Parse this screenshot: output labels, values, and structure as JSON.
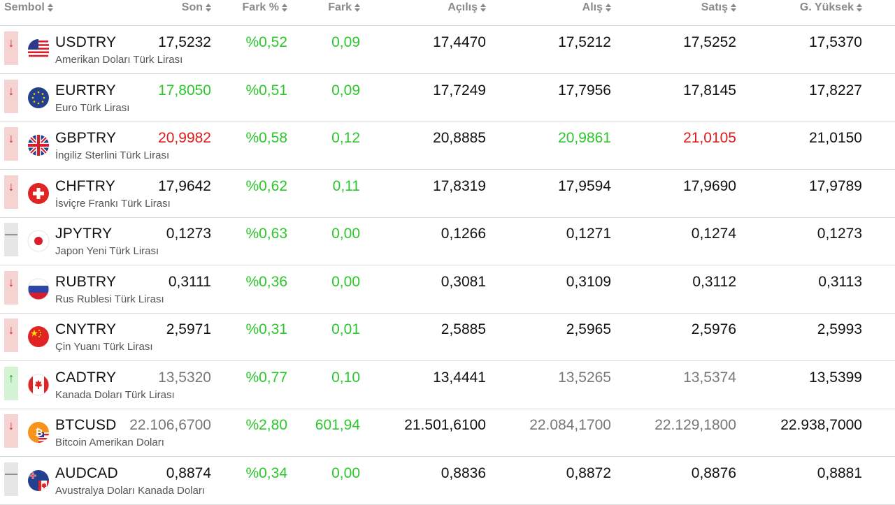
{
  "header": {
    "columns": [
      {
        "label": "Sembol",
        "name": "sembol"
      },
      {
        "label": "Son",
        "name": "son"
      },
      {
        "label": "Fark %",
        "name": "fark-yuzde"
      },
      {
        "label": "Fark",
        "name": "fark"
      },
      {
        "label": "Açılış",
        "name": "acilis"
      },
      {
        "label": "Alış",
        "name": "alis"
      },
      {
        "label": "Satış",
        "name": "satis"
      },
      {
        "label": "G. Yüksek",
        "name": "gunluk-yuksek"
      }
    ]
  },
  "colors": {
    "up": "#2bc82b",
    "down": "#e0191a",
    "neutral": "#777777",
    "default": "#111111"
  },
  "rows": [
    {
      "symbol": "USDTRY",
      "desc": "Amerikan Doları Türk Lirası",
      "trend": "down",
      "flag": "usa-flag-icon",
      "son": "17,5232",
      "son_c": "black",
      "farkp": "%0,52",
      "farkp_c": "green",
      "fark": "0,09",
      "fark_c": "green",
      "acilis": "17,4470",
      "acilis_c": "black",
      "alis": "17,5212",
      "alis_c": "black",
      "satis": "17,5252",
      "satis_c": "black",
      "yuksek": "17,5370",
      "yuksek_c": "black"
    },
    {
      "symbol": "EURTRY",
      "desc": "Euro Türk Lirası",
      "trend": "down",
      "flag": "eu-flag-icon",
      "son": "17,8050",
      "son_c": "green",
      "farkp": "%0,51",
      "farkp_c": "green",
      "fark": "0,09",
      "fark_c": "green",
      "acilis": "17,7249",
      "acilis_c": "black",
      "alis": "17,7956",
      "alis_c": "black",
      "satis": "17,8145",
      "satis_c": "black",
      "yuksek": "17,8227",
      "yuksek_c": "black"
    },
    {
      "symbol": "GBPTRY",
      "desc": "İngiliz Sterlini Türk Lirası",
      "trend": "down",
      "flag": "uk-flag-icon",
      "son": "20,9982",
      "son_c": "red",
      "farkp": "%0,58",
      "farkp_c": "green",
      "fark": "0,12",
      "fark_c": "green",
      "acilis": "20,8885",
      "acilis_c": "black",
      "alis": "20,9861",
      "alis_c": "green",
      "satis": "21,0105",
      "satis_c": "red",
      "yuksek": "21,0150",
      "yuksek_c": "black"
    },
    {
      "symbol": "CHFTRY",
      "desc": "İsviçre Frankı Türk Lirası",
      "trend": "down",
      "flag": "swiss-flag-icon",
      "son": "17,9642",
      "son_c": "black",
      "farkp": "%0,62",
      "farkp_c": "green",
      "fark": "0,11",
      "fark_c": "green",
      "acilis": "17,8319",
      "acilis_c": "black",
      "alis": "17,9594",
      "alis_c": "black",
      "satis": "17,9690",
      "satis_c": "black",
      "yuksek": "17,9789",
      "yuksek_c": "black"
    },
    {
      "symbol": "JPYTRY",
      "desc": "Japon Yeni Türk Lirası",
      "trend": "flat",
      "flag": "japan-flag-icon",
      "son": "0,1273",
      "son_c": "black",
      "farkp": "%0,63",
      "farkp_c": "green",
      "fark": "0,00",
      "fark_c": "green",
      "acilis": "0,1266",
      "acilis_c": "black",
      "alis": "0,1271",
      "alis_c": "black",
      "satis": "0,1274",
      "satis_c": "black",
      "yuksek": "0,1273",
      "yuksek_c": "black"
    },
    {
      "symbol": "RUBTRY",
      "desc": "Rus Rublesi Türk Lirası",
      "trend": "down",
      "flag": "russia-flag-icon",
      "son": "0,3111",
      "son_c": "black",
      "farkp": "%0,36",
      "farkp_c": "green",
      "fark": "0,00",
      "fark_c": "green",
      "acilis": "0,3081",
      "acilis_c": "black",
      "alis": "0,3109",
      "alis_c": "black",
      "satis": "0,3112",
      "satis_c": "black",
      "yuksek": "0,3113",
      "yuksek_c": "black"
    },
    {
      "symbol": "CNYTRY",
      "desc": "Çin Yuanı Türk Lirası",
      "trend": "down",
      "flag": "china-flag-icon",
      "son": "2,5971",
      "son_c": "black",
      "farkp": "%0,31",
      "farkp_c": "green",
      "fark": "0,01",
      "fark_c": "green",
      "acilis": "2,5885",
      "acilis_c": "black",
      "alis": "2,5965",
      "alis_c": "black",
      "satis": "2,5976",
      "satis_c": "black",
      "yuksek": "2,5993",
      "yuksek_c": "black"
    },
    {
      "symbol": "CADTRY",
      "desc": "Kanada Doları Türk Lirası",
      "trend": "up",
      "flag": "canada-flag-icon",
      "son": "13,5320",
      "son_c": "gray",
      "farkp": "%0,77",
      "farkp_c": "green",
      "fark": "0,10",
      "fark_c": "green",
      "acilis": "13,4441",
      "acilis_c": "black",
      "alis": "13,5265",
      "alis_c": "gray",
      "satis": "13,5374",
      "satis_c": "gray",
      "yuksek": "13,5399",
      "yuksek_c": "black"
    },
    {
      "symbol": "BTCUSD",
      "desc": "Bitcoin Amerikan Doları",
      "trend": "down",
      "flag": "bitcoin-flag-icon",
      "son": "22.106,6700",
      "son_c": "gray",
      "farkp": "%2,80",
      "farkp_c": "green",
      "fark": "601,94",
      "fark_c": "green",
      "acilis": "21.501,6100",
      "acilis_c": "black",
      "alis": "22.084,1700",
      "alis_c": "gray",
      "satis": "22.129,1800",
      "satis_c": "gray",
      "yuksek": "22.938,7000",
      "yuksek_c": "black"
    },
    {
      "symbol": "AUDCAD",
      "desc": "Avustralya Doları Kanada Doları",
      "trend": "flat",
      "flag": "australia-flag-icon",
      "son": "0,8874",
      "son_c": "black",
      "farkp": "%0,34",
      "farkp_c": "green",
      "fark": "0,00",
      "fark_c": "green",
      "acilis": "0,8836",
      "acilis_c": "black",
      "alis": "0,8872",
      "alis_c": "black",
      "satis": "0,8876",
      "satis_c": "black",
      "yuksek": "0,8881",
      "yuksek_c": "black"
    }
  ]
}
